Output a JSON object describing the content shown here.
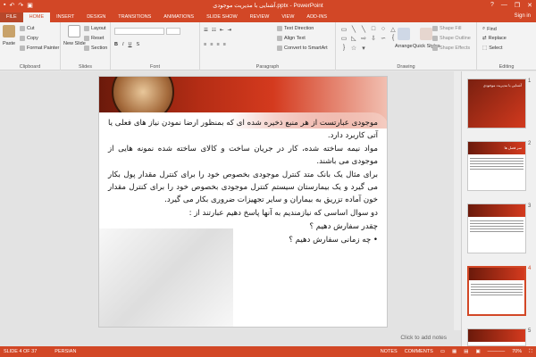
{
  "window": {
    "title": "آشنایی با مدیریت موجودی.pptx - PowerPoint",
    "help": "?",
    "minimize": "—",
    "restore": "❐",
    "close": "✕"
  },
  "tabs": [
    {
      "label": "FILE"
    },
    {
      "label": "HOME"
    },
    {
      "label": "INSERT"
    },
    {
      "label": "DESIGN"
    },
    {
      "label": "TRANSITIONS"
    },
    {
      "label": "ANIMATIONS"
    },
    {
      "label": "SLIDE SHOW"
    },
    {
      "label": "REVIEW"
    },
    {
      "label": "VIEW"
    },
    {
      "label": "ADD-INS"
    }
  ],
  "signin": "Sign in",
  "ribbon": {
    "clipboard": {
      "label": "Clipboard",
      "paste": "Paste",
      "cut": "Cut",
      "copy": "Copy",
      "format_painter": "Format Painter"
    },
    "slides": {
      "label": "Slides",
      "new_slide": "New Slide",
      "layout": "Layout",
      "reset": "Reset",
      "section": "Section"
    },
    "font": {
      "label": "Font"
    },
    "paragraph": {
      "label": "Paragraph",
      "text_direction": "Text Direction",
      "align_text": "Align Text",
      "smartart": "Convert to SmartArt"
    },
    "drawing": {
      "label": "Drawing",
      "arrange": "Arrange",
      "quick_styles": "Quick Styles",
      "shape_fill": "Shape Fill",
      "shape_outline": "Shape Outline",
      "shape_effects": "Shape Effects"
    },
    "editing": {
      "label": "Editing",
      "find": "Find",
      "replace": "Replace",
      "select": "Select"
    }
  },
  "slide": {
    "paragraphs": [
      "موجودی عبارتست از هر منبع ذخیره شده ای که بمنظور ارضا نمودن نیاز های فعلی یا آتی کاربرد دارد.",
      "مواد نیمه ساخته شده، کار در جریان ساخت و کالای ساخته شده نمونه هایی از موجودی می باشند.",
      "برای مثال یک بانک متد کنترل موجودی بخصوص خود را برای کنترل مقدار پول بکار می گیرد و یک بیمارستان سیستم کنترل موجودی بخصوص خود را برای کنترل مقدار خون آماده تزریق به بیماران و سایر تجهیزات ضروری بکار می گیرد.",
      "دو سوال اساسی که نیازمندیم به آنها پاسخ دهیم عبارتند از :",
      "چقدر سفارش دهیم ؟",
      "• چه زمانی سفارش دهیم ؟"
    ]
  },
  "notes_placeholder": "Click to add notes",
  "thumbnails": [
    {
      "num": "1",
      "title": "آشنایی با مدیریت موجودی"
    },
    {
      "num": "2",
      "title": "سر فصل ها"
    },
    {
      "num": "3",
      "title": ""
    },
    {
      "num": "4",
      "title": ""
    },
    {
      "num": "5",
      "title": ""
    }
  ],
  "status": {
    "slide_indicator": "SLIDE 4 OF 37",
    "language": "PERSIAN",
    "notes": "NOTES",
    "comments": "COMMENTS",
    "zoom": "70%"
  },
  "colors": {
    "accent": "#d24726"
  }
}
